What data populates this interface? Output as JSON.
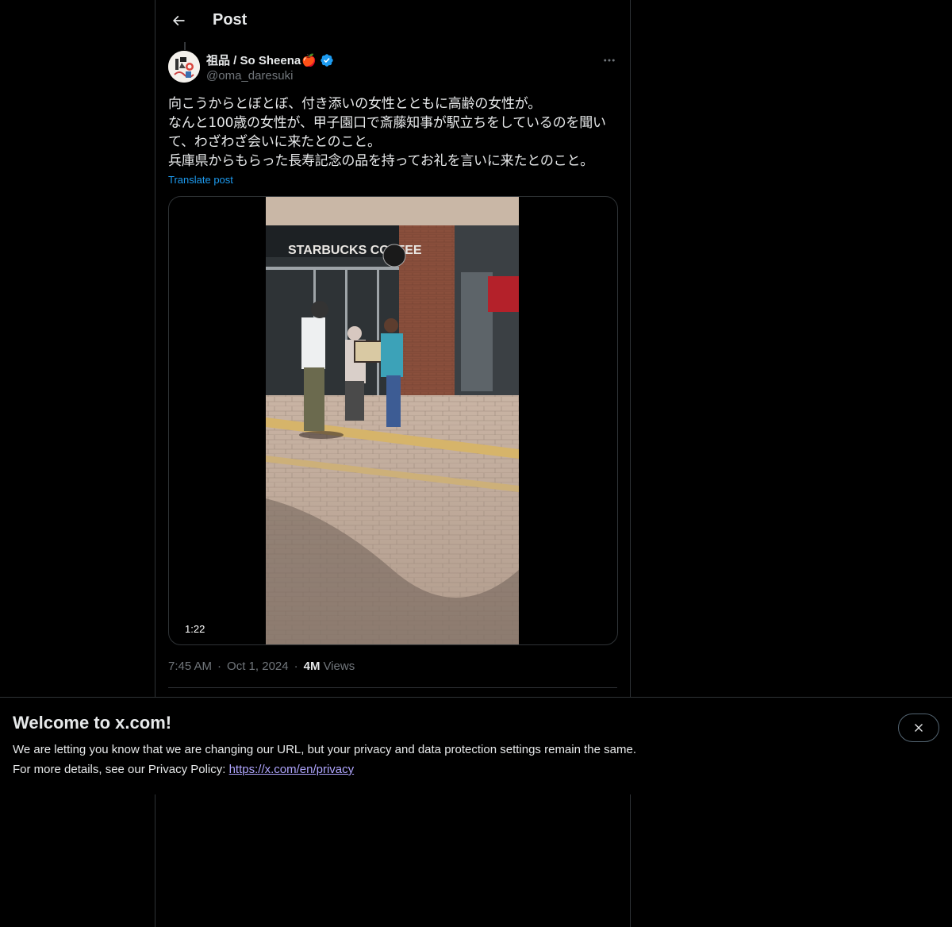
{
  "header": {
    "title": "Post",
    "back_icon": "arrow-left-icon"
  },
  "post": {
    "author": {
      "name": "祖品 / So Sheena",
      "handle": "@oma_daresuki",
      "emoji": "🍎",
      "verified": true,
      "verified_color": "#1d9bf0"
    },
    "text": "向こうからとぼとぼ、付き添いの女性とともに高齢の女性が。\nなんと100歳の女性が、甲子園口で斎藤知事が駅立ちをしているのを聞い\nて、わざわざ会いに来たとのこと。\n兵庫県からもらった長寿記念の品を持ってお礼を言いに来たとのこと。",
    "translate_label": "Translate post",
    "video": {
      "duration": "1:22",
      "sign_text": "STARBUCKS COFFEE"
    },
    "time": "7:45 AM",
    "date": "Oct 1, 2024",
    "views_count": "4M",
    "views_label": "Views"
  },
  "banner": {
    "title": "Welcome to x.com!",
    "line1": "We are letting you know that we are changing our URL, but your privacy and data protection settings remain the same.",
    "line2_prefix": "For more details, see our Privacy Policy: ",
    "link": "https://x.com/en/privacy",
    "close_icon": "close-icon"
  },
  "colors": {
    "background": "#000000",
    "text": "#e7e9ea",
    "muted": "#71767b",
    "accent": "#1d9bf0",
    "border": "#2f3336",
    "link_visited": "#b0a6ff"
  }
}
